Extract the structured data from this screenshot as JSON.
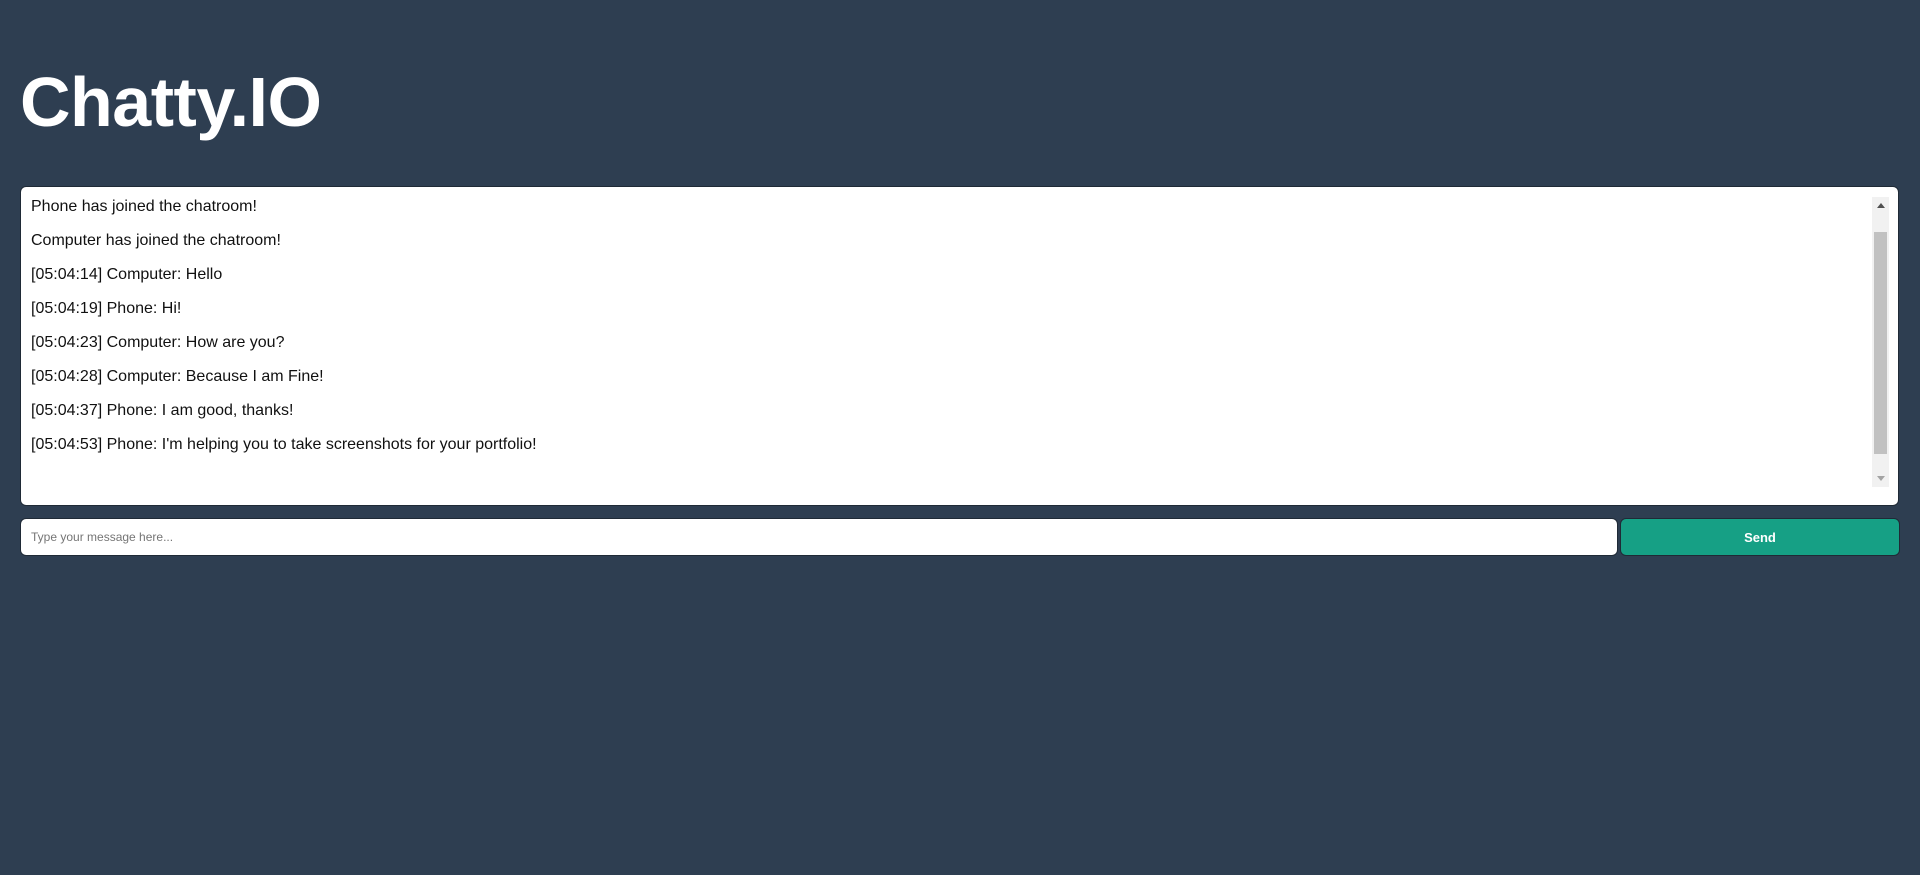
{
  "app": {
    "title": "Chatty.IO"
  },
  "chat": {
    "messages": [
      "Phone has joined the chatroom!",
      "Computer has joined the chatroom!",
      "[05:04:14] Computer: Hello",
      "[05:04:19] Phone: Hi!",
      "[05:04:23] Computer: How are you?",
      "[05:04:28] Computer: Because I am Fine!",
      "[05:04:37] Phone: I am good, thanks!",
      "[05:04:53] Phone: I'm helping you to take screenshots for your portfolio!"
    ]
  },
  "composer": {
    "input_value": "",
    "placeholder": "Type your message here...",
    "send_label": "Send"
  },
  "colors": {
    "background": "#2e3e51",
    "title": "#ffffff",
    "send_button": "#16a085",
    "panel": "#ffffff"
  },
  "icons": {
    "scroll_up": "triangle-up-icon",
    "scroll_down": "triangle-down-icon"
  }
}
